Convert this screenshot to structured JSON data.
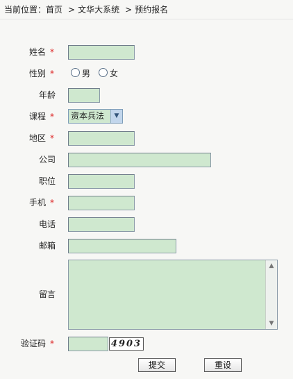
{
  "breadcrumb": {
    "prefix": "当前位置：",
    "home": "首页",
    "separator": ">",
    "section": "文华大系统",
    "current": "预约报名"
  },
  "form": {
    "name_label": "姓名",
    "gender_label": "性别",
    "gender_male": "男",
    "gender_female": "女",
    "age_label": "年龄",
    "course_label": "课程",
    "course_selected": "资本兵法",
    "region_label": "地区",
    "company_label": "公司",
    "position_label": "职位",
    "mobile_label": "手机",
    "phone_label": "电话",
    "email_label": "邮箱",
    "message_label": "留言",
    "captcha_label": "验证码",
    "captcha_code": "4903",
    "required_mark": "*"
  },
  "buttons": {
    "submit": "提交",
    "reset": "重设"
  },
  "colors": {
    "field_bg": "#cfe8cf",
    "required": "#dd2222",
    "page_bg": "#f7f7f5"
  }
}
